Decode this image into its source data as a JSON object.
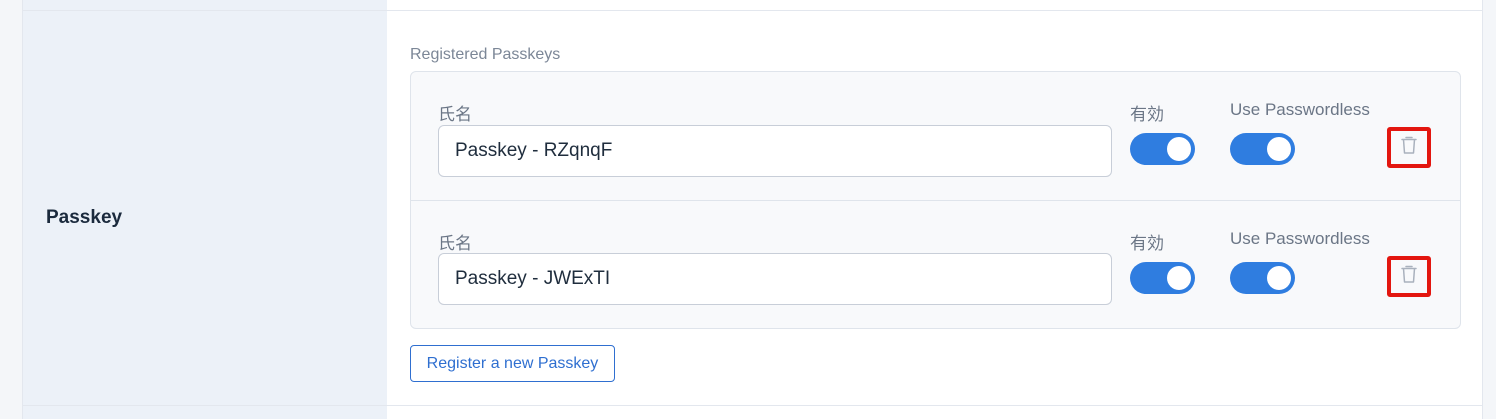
{
  "row": {
    "label": "Passkey"
  },
  "section": {
    "title": "Registered Passkeys"
  },
  "passkeys": [
    {
      "name_label": "氏名",
      "name_value": "Passkey - RZqnqF",
      "enabled_label": "有効",
      "enabled": true,
      "passwordless_label": "Use Passwordless",
      "passwordless": true,
      "delete_icon": "trash-icon"
    },
    {
      "name_label": "氏名",
      "name_value": "Passkey - JWExTI",
      "enabled_label": "有効",
      "enabled": true,
      "passwordless_label": "Use Passwordless",
      "passwordless": true,
      "delete_icon": "trash-icon"
    }
  ],
  "actions": {
    "register_label": "Register a new Passkey"
  },
  "colors": {
    "accent": "#2f7de0",
    "highlight": "#e3160f",
    "label_bg": "#ecf1f8"
  }
}
